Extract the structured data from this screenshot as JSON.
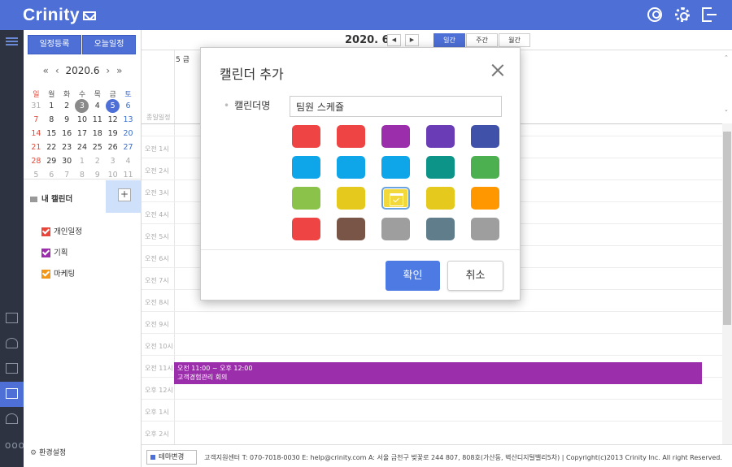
{
  "app": {
    "logo": "Crinity"
  },
  "sidebar": {
    "add_schedule": "일정등록",
    "today_schedule": "오늘일정",
    "mini_nav": {
      "prev_year": "«",
      "prev_month": "‹",
      "title": "2020.6",
      "next_month": "›",
      "next_year": "»"
    },
    "weekdays": [
      "일",
      "월",
      "화",
      "수",
      "목",
      "금",
      "토"
    ],
    "weeks": [
      [
        "31",
        "1",
        "2",
        "3",
        "4",
        "5",
        "6"
      ],
      [
        "7",
        "8",
        "9",
        "10",
        "11",
        "12",
        "13"
      ],
      [
        "14",
        "15",
        "16",
        "17",
        "18",
        "19",
        "20"
      ],
      [
        "21",
        "22",
        "23",
        "24",
        "25",
        "26",
        "27"
      ],
      [
        "28",
        "29",
        "30",
        "1",
        "2",
        "3",
        "4"
      ],
      [
        "5",
        "6",
        "7",
        "8",
        "9",
        "10",
        "11"
      ]
    ],
    "today_day": "3",
    "selected_day": "5",
    "my_calendars_title": "내 캘린더",
    "add_label": "+",
    "calendars": [
      {
        "name": "개인일정",
        "color": "#e8463b"
      },
      {
        "name": "기획",
        "color": "#9b2eaa"
      },
      {
        "name": "마케팅",
        "color": "#f2961a"
      }
    ],
    "settings_label": "환경설정"
  },
  "main": {
    "month_title": "2020. 6",
    "prev": "◀",
    "next": "▶",
    "views": [
      "일간",
      "주간",
      "월간"
    ],
    "active_view": "일간",
    "day_header": "5 금",
    "allday_label": "종일일정",
    "hours": [
      "오전 1시",
      "오전 2시",
      "오전 3시",
      "오전 4시",
      "오전 5시",
      "오전 6시",
      "오전 7시",
      "오전 8시",
      "오전 9시",
      "오전 10시",
      "오전 11시",
      "오후 12시",
      "오후 1시",
      "오후 2시"
    ],
    "event": {
      "time": "오전 11:00 ~ 오후 12:00",
      "title": "고객경험관리 회의",
      "color": "#9b2eaa"
    }
  },
  "footer": {
    "theme_button": "테마변경",
    "info": "고객지원센터 T: 070-7018-0030 E: help@crinity.com A: 서울 금천구 벚꽃로 244 807, 808호(가산동, 벽산디지털밸리5차) | Copyright(c)2013 Crinity Inc. All right Reserved."
  },
  "modal": {
    "title": "캘린더 추가",
    "name_label": "캘린더명",
    "name_value": "팀원 스케쥴",
    "colors": [
      "#ef4444",
      "#ef4444",
      "#9b2eaa",
      "#6a3cb5",
      "#3f51a8",
      "#0ea5e9",
      "#0ea5e9",
      "#0ea5e9",
      "#0d9488",
      "#4caf50",
      "#8bc34a",
      "#e5c91c",
      "#f3d83b",
      "#e5c91c",
      "#ff9800",
      "#ef4444",
      "#795548",
      "#9e9e9e",
      "#607d8b",
      "#9e9e9e"
    ],
    "selected_color_index": 12,
    "confirm": "확인",
    "cancel": "취소"
  }
}
